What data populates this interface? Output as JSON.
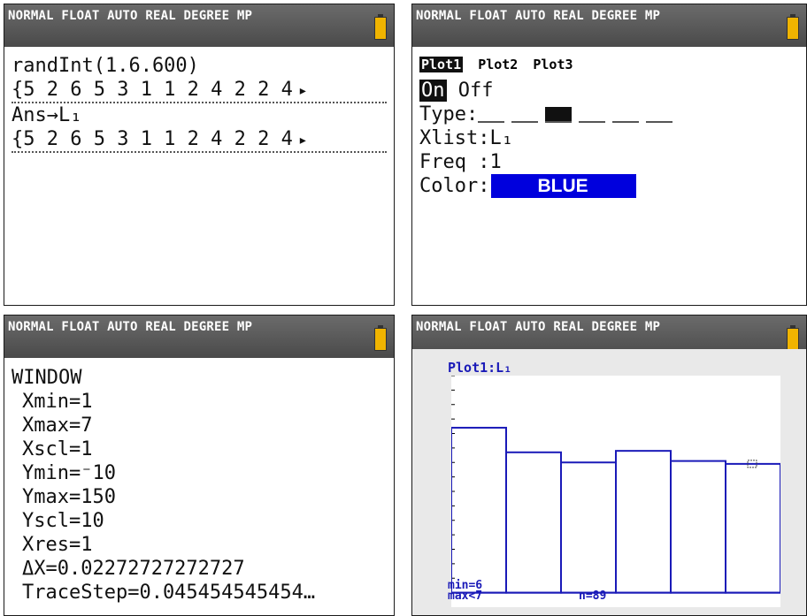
{
  "status_bar": {
    "text": "NORMAL FLOAT AUTO REAL DEGREE MP"
  },
  "home": {
    "line1": "randInt(1.6.600)",
    "line2": "{5 2 6 5 3 1 1 2 4 2 2 4",
    "line3": "Ans→L₁",
    "line4": "{5 2 6 5 3 1 1 2 4 2 2 4",
    "arrow": "▸"
  },
  "statplot": {
    "tabs": [
      "Plot1",
      "Plot2",
      "Plot3"
    ],
    "on_label": "On",
    "off_label": "Off",
    "type_label": "Type:",
    "xlist": "Xlist:L₁",
    "freq": "Freq :1",
    "color_label": "Color:",
    "color_value": "BLUE",
    "color_hex": "#0000dd"
  },
  "window": {
    "header": "WINDOW",
    "lines": [
      "Xmin=1",
      "Xmax=7",
      "Xscl=1",
      "Ymin=⁻10",
      "Ymax=150",
      "Yscl=10",
      "Xres=1",
      "ΔX=0.02272727272727",
      "TraceStep=0.045454545454…"
    ]
  },
  "graph": {
    "title": "Plot1:L₁",
    "info_min": "min=6",
    "info_max": "max<7",
    "info_n": "n=89",
    "color": "#1a1ab8"
  },
  "chart_data": {
    "type": "bar",
    "categories": [
      "1",
      "2",
      "3",
      "4",
      "5",
      "6"
    ],
    "values": [
      114,
      97,
      90,
      98,
      91,
      89
    ],
    "xlim": [
      1,
      7
    ],
    "ylim": [
      -10,
      150
    ],
    "xscl": 1,
    "yscl": 10,
    "title": "Plot1:L₁"
  }
}
